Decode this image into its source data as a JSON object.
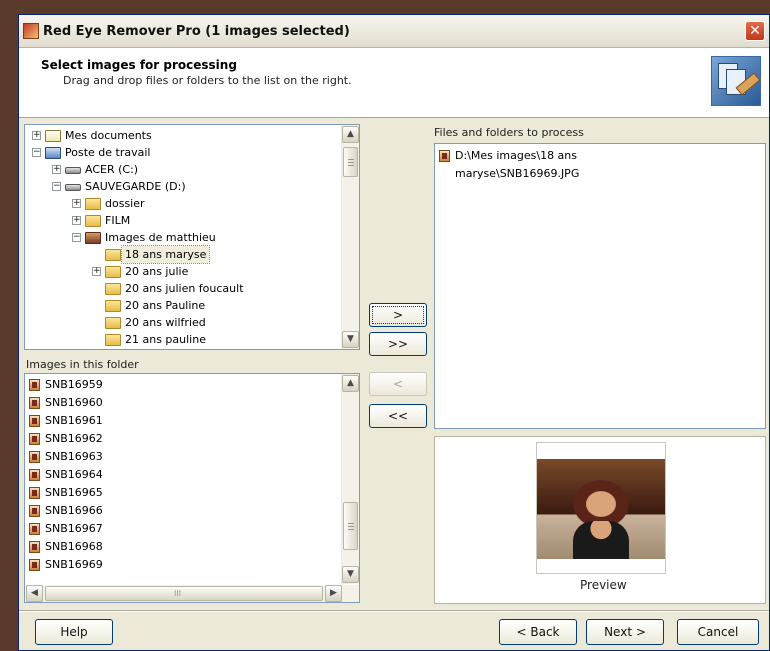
{
  "window": {
    "title": "Red Eye Remover Pro (1 images selected)"
  },
  "header": {
    "title": "Select images for processing",
    "subtitle": "Drag and drop files or folders to the list on the right."
  },
  "tree": [
    {
      "label": "Mes documents",
      "icon": "documents-folder-icon",
      "expander": "+"
    },
    {
      "label": "Poste de travail",
      "icon": "computer-icon",
      "expander": "-"
    },
    {
      "label": "ACER (C:)",
      "icon": "drive-icon",
      "expander": "+"
    },
    {
      "label": "SAUVEGARDE (D:)",
      "icon": "drive-icon",
      "expander": "-"
    },
    {
      "label": "dossier",
      "icon": "folder-icon",
      "expander": "+"
    },
    {
      "label": "FILM",
      "icon": "folder-icon",
      "expander": "+"
    },
    {
      "label": "Images de matthieu",
      "icon": "pictures-folder-icon",
      "expander": "-"
    },
    {
      "label": "18 ans maryse",
      "icon": "open-folder-icon",
      "expander": "",
      "selected": true
    },
    {
      "label": "20 ans julie",
      "icon": "folder-icon",
      "expander": "+"
    },
    {
      "label": "20 ans julien foucault",
      "icon": "folder-icon",
      "expander": ""
    },
    {
      "label": "20 ans Pauline",
      "icon": "folder-icon",
      "expander": ""
    },
    {
      "label": "20 ans wilfried",
      "icon": "folder-icon",
      "expander": ""
    },
    {
      "label": "21 ans pauline",
      "icon": "folder-icon",
      "expander": ""
    }
  ],
  "images_label": "Images in this folder",
  "images": [
    "SNB16959",
    "SNB16960",
    "SNB16961",
    "SNB16962",
    "SNB16963",
    "SNB16964",
    "SNB16965",
    "SNB16966",
    "SNB16967",
    "SNB16968",
    "SNB16969"
  ],
  "files_label": "Files and folders to process",
  "files": [
    "D:\\Mes images\\18 ans maryse\\SNB16969.JPG"
  ],
  "transfer": {
    "add": ">",
    "add_all": ">>",
    "remove": "<",
    "remove_all": "<<"
  },
  "preview_label": "Preview",
  "buttons": {
    "help": "Help",
    "back": "< Back",
    "next": "Next >",
    "cancel": "Cancel"
  },
  "hscroll_grip": "III"
}
